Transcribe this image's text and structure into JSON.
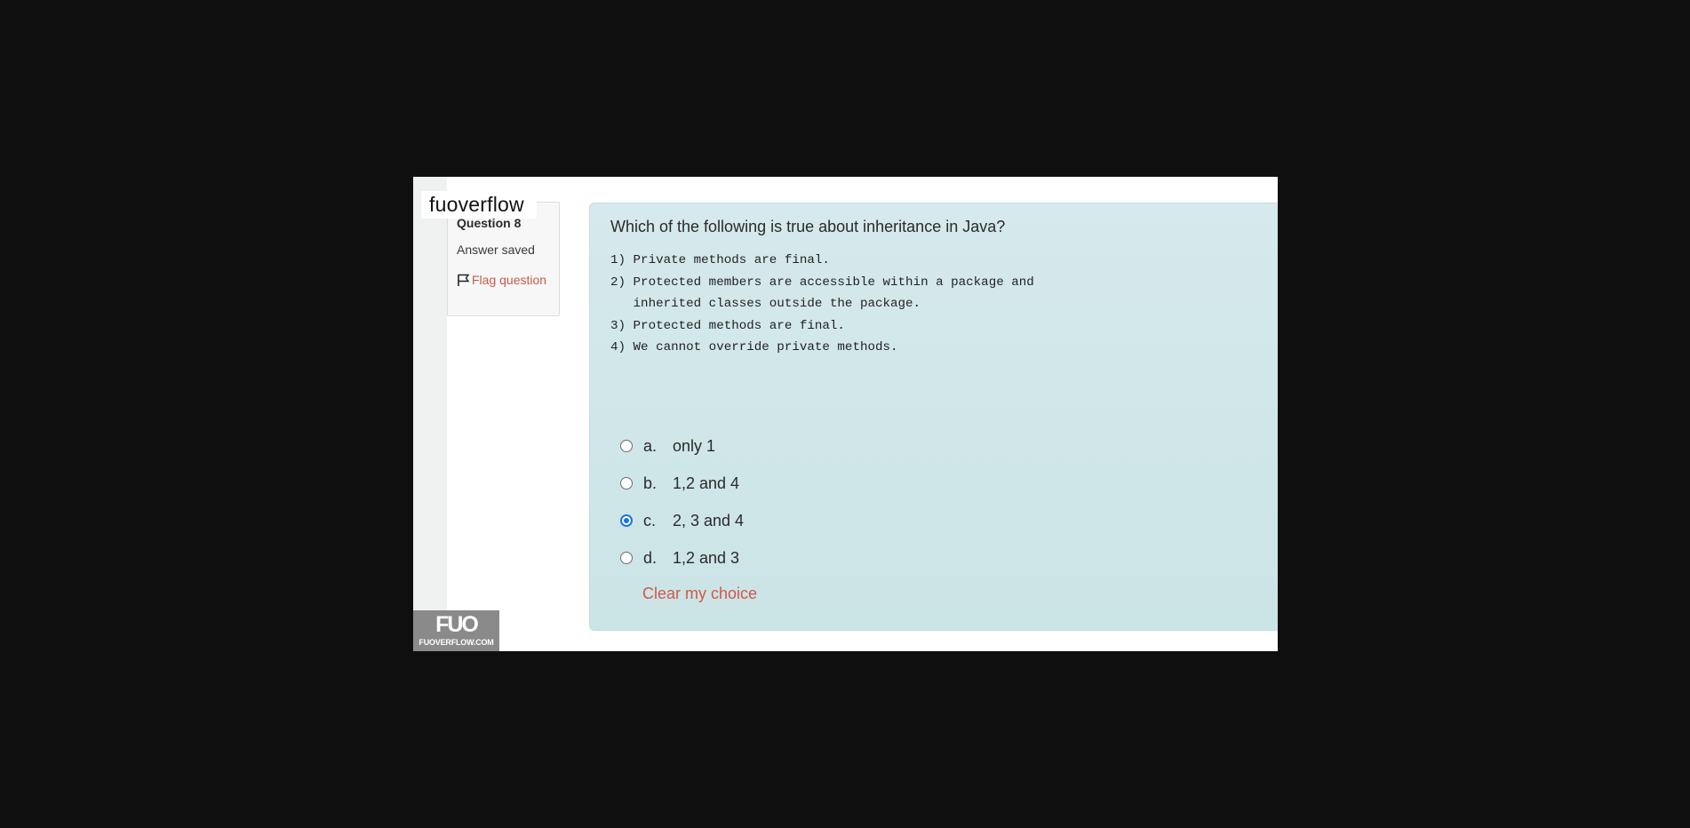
{
  "watermark": {
    "text": "fuoverflow"
  },
  "info": {
    "question_label": "Question",
    "question_number": "8",
    "state": "Answer saved",
    "flag_label": "Flag question"
  },
  "question": {
    "text": "Which of the following is true about inheritance in Java?",
    "code_lines": [
      "1) Private methods are final.",
      "2) Protected members are accessible within a package and",
      "   inherited classes outside the package.",
      "3) Protected methods are final.",
      "4) We cannot override private methods."
    ]
  },
  "answers": [
    {
      "letter": "a.",
      "text": "only 1",
      "selected": false
    },
    {
      "letter": "b.",
      "text": "1,2 and 4",
      "selected": false
    },
    {
      "letter": "c.",
      "text": "2, 3 and 4",
      "selected": true
    },
    {
      "letter": "d.",
      "text": "1,2 and 3",
      "selected": false
    }
  ],
  "clear_label": "Clear my choice",
  "logo": {
    "mark": "FUO",
    "text": "FUOVERFLOW.COM"
  },
  "colors": {
    "background": "#0f0f0f",
    "content_panel": "#cfe6e8",
    "link": "#c65a48",
    "radio_selected": "#1a73e8"
  }
}
